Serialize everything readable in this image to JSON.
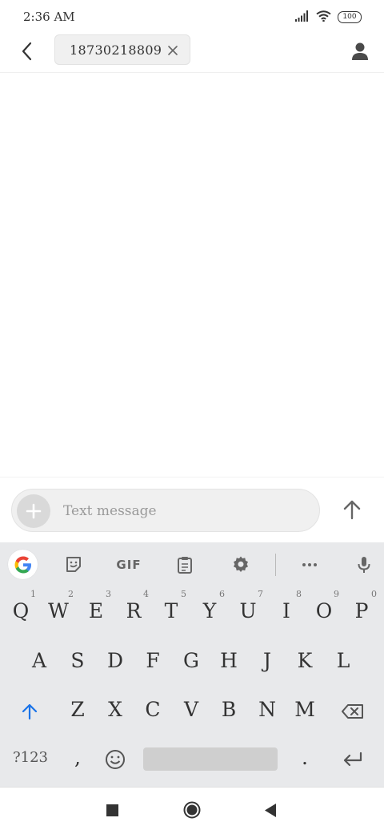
{
  "status_bar": {
    "time": "2:36 AM",
    "battery": "100",
    "icons": [
      "signal-icon",
      "wifi-icon",
      "battery-icon"
    ]
  },
  "header": {
    "recipient_chip": "18730218809",
    "icons": [
      "back-arrow-icon",
      "close-icon",
      "contact-icon"
    ]
  },
  "composer": {
    "placeholder": "Text message",
    "value": ""
  },
  "keyboard": {
    "toolbar_gif": "GIF",
    "row1": [
      {
        "label": "Q",
        "hint": "1"
      },
      {
        "label": "W",
        "hint": "2"
      },
      {
        "label": "E",
        "hint": "3"
      },
      {
        "label": "R",
        "hint": "4"
      },
      {
        "label": "T",
        "hint": "5"
      },
      {
        "label": "Y",
        "hint": "6"
      },
      {
        "label": "U",
        "hint": "7"
      },
      {
        "label": "I",
        "hint": "8"
      },
      {
        "label": "O",
        "hint": "9"
      },
      {
        "label": "P",
        "hint": "0"
      }
    ],
    "row2": [
      "A",
      "S",
      "D",
      "F",
      "G",
      "H",
      "J",
      "K",
      "L"
    ],
    "row3": [
      "Z",
      "X",
      "C",
      "V",
      "B",
      "N",
      "M"
    ],
    "row4": {
      "symbols": "?123",
      "comma": ",",
      "period": "."
    }
  },
  "colors": {
    "accent_blue": "#1a73e8",
    "keyboard_bg": "#e8e9eb",
    "chip_bg": "#f0f0f0"
  }
}
